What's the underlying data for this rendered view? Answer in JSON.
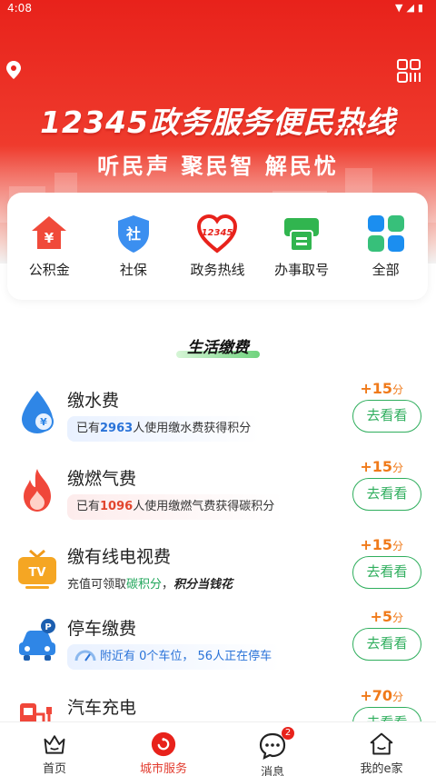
{
  "status_bar": {
    "time": "4:08"
  },
  "banner": {
    "title": "12345政务服务便民热线",
    "subtitle": "听民声 聚民智 解民忧"
  },
  "quick_services": [
    {
      "label": "公积金",
      "icon": "housing-fund-icon"
    },
    {
      "label": "社保",
      "icon": "social-security-icon"
    },
    {
      "label": "政务热线",
      "icon": "hotline-heart-icon"
    },
    {
      "label": "办事取号",
      "icon": "ticket-machine-icon"
    },
    {
      "label": "全部",
      "icon": "grid-all-icon"
    }
  ],
  "section": {
    "title": "生活缴费"
  },
  "payments": [
    {
      "name": "缴水费",
      "points": "+15",
      "points_unit": "分",
      "tip_pre": "已有",
      "tip_num": "2963",
      "tip_post": "人使用缴水费获得积分",
      "button": "去看看"
    },
    {
      "name": "缴燃气费",
      "points": "+15",
      "points_unit": "分",
      "tip_pre": "已有",
      "tip_num": "1096",
      "tip_post": "人使用缴燃气费获得碳积分",
      "button": "去看看"
    },
    {
      "name": "缴有线电视费",
      "points": "+15",
      "points_unit": "分",
      "tip_pre": "充值可领取",
      "tip_num": "碳积分",
      "tip_post": "，",
      "tip_bold": "积分当钱花",
      "button": "去看看"
    },
    {
      "name": "停车缴费",
      "points": "+5",
      "points_unit": "分",
      "tip_text": "附近有 0个车位， 56人正在停车",
      "button": "去看看"
    },
    {
      "name": "汽车充电",
      "points": "+70",
      "points_unit": "分",
      "button": "去看看"
    }
  ],
  "tabbar": [
    {
      "label": "首页",
      "icon": "home-crown-icon"
    },
    {
      "label": "城市服务",
      "icon": "city-service-icon",
      "active": true
    },
    {
      "label": "消息",
      "icon": "message-icon",
      "badge": "2"
    },
    {
      "label": "我的e家",
      "icon": "my-home-icon"
    }
  ],
  "colors": {
    "brand_red": "#e8221b",
    "accent_green": "#2fae5d",
    "points_orange": "#f07a1a"
  }
}
